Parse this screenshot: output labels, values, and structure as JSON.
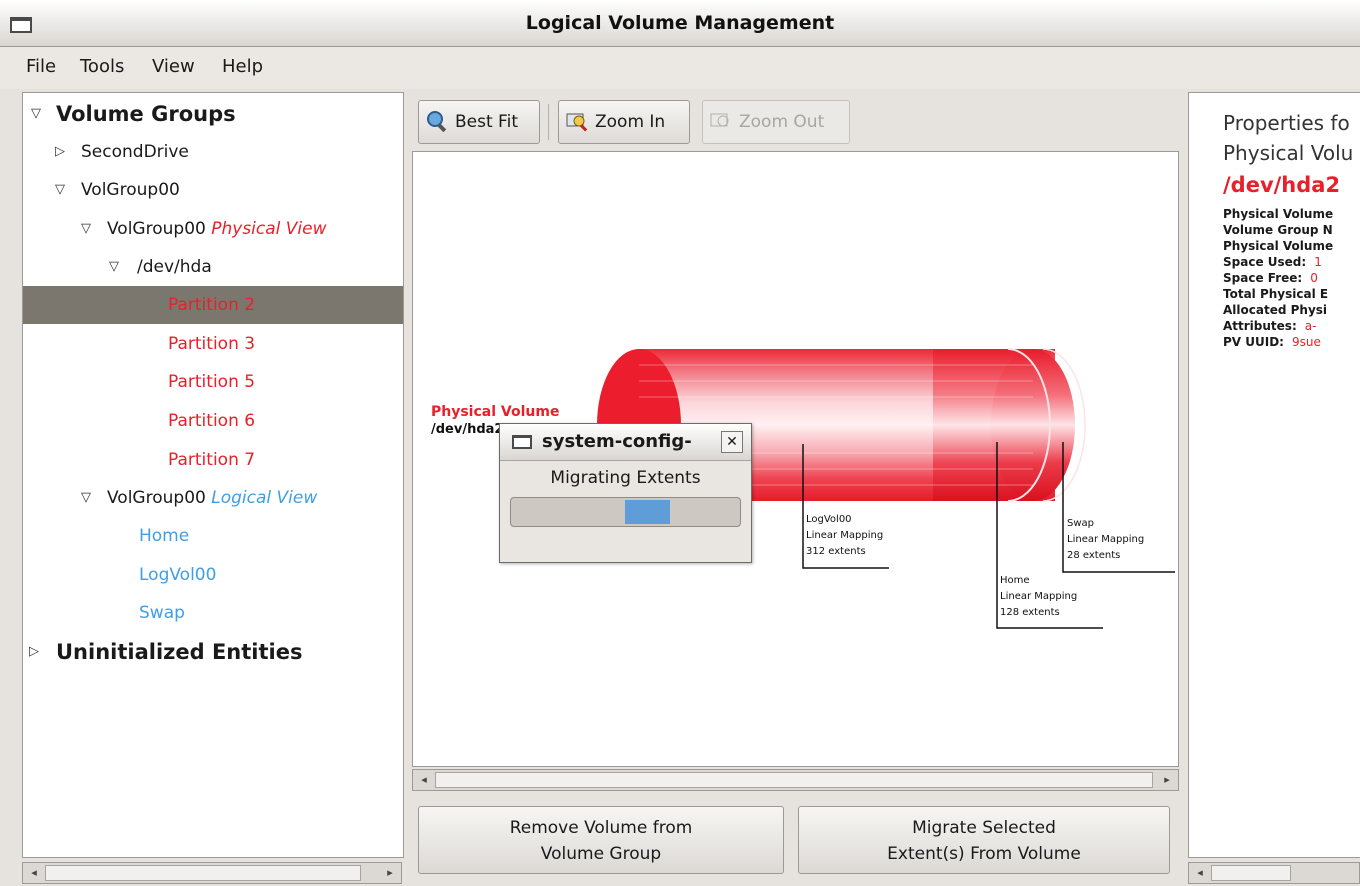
{
  "window": {
    "title": "Logical Volume Management"
  },
  "menu": {
    "file": "File",
    "tools": "Tools",
    "view": "View",
    "help": "Help"
  },
  "tree": {
    "volume_groups": "Volume Groups",
    "second_drive": "SecondDrive",
    "volgroup00": "VolGroup00",
    "physical_view_name": "VolGroup00",
    "physical_view_suffix": "Physical View",
    "dev_hda": "/dev/hda",
    "partitions": [
      "Partition 2",
      "Partition 3",
      "Partition 5",
      "Partition 6",
      "Partition 7"
    ],
    "logical_view_name": "VolGroup00",
    "logical_view_suffix": "Logical View",
    "logical_volumes": [
      "Home",
      "LogVol00",
      "Swap"
    ],
    "uninitialized": "Uninitialized Entities"
  },
  "toolbar": {
    "best_fit": "Best Fit",
    "zoom_in": "Zoom In",
    "zoom_out": "Zoom Out"
  },
  "canvas": {
    "pv_title": "Physical Volume",
    "pv_device": "/dev/hda2",
    "labels": [
      {
        "name": "LogVol00",
        "mapping": "Linear Mapping",
        "extents": "312 extents"
      },
      {
        "name": "Home",
        "mapping": "Linear Mapping",
        "extents": "128 extents"
      },
      {
        "name": "Swap",
        "mapping": "Linear Mapping",
        "extents": "28 extents"
      }
    ]
  },
  "buttons": {
    "remove_line1": "Remove Volume from",
    "remove_line2": "Volume Group",
    "migrate_line1": "Migrate Selected",
    "migrate_line2": "Extent(s) From Volume"
  },
  "properties": {
    "heading_line1": "Properties fo",
    "heading_line2": "Physical Volu",
    "device": "/dev/hda2",
    "rows": [
      {
        "key": "Physical Volume",
        "value": ""
      },
      {
        "key": "Volume Group N",
        "value": ""
      },
      {
        "key": "Physical Volume",
        "value": ""
      },
      {
        "key": "Space Used:",
        "value": "1"
      },
      {
        "key": "Space Free:",
        "value": "0"
      },
      {
        "key": "Total Physical E",
        "value": ""
      },
      {
        "key": "Allocated Physi",
        "value": ""
      },
      {
        "key": "Attributes:",
        "value": "a-"
      },
      {
        "key": "PV UUID:",
        "value": "9sue"
      }
    ]
  },
  "dialog": {
    "title": "system-config-",
    "message": "Migrating Extents",
    "progress_fraction": 0.2
  },
  "colors": {
    "accent_red": "#e8202a",
    "logical_blue": "#3f9fe6",
    "selection": "#7b776f"
  }
}
